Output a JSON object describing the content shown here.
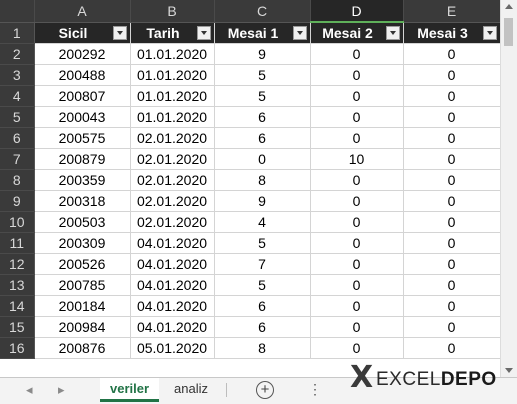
{
  "columns": [
    "A",
    "B",
    "C",
    "D",
    "E"
  ],
  "selected_column": "D",
  "header_row_number": "1",
  "headers": [
    "Sicil",
    "Tarih",
    "Mesai 1",
    "Mesai 2",
    "Mesai 3"
  ],
  "rows": [
    {
      "n": "2",
      "sicil": "200292",
      "tarih": "01.01.2020",
      "m1": "9",
      "m2": "0",
      "m3": "0"
    },
    {
      "n": "3",
      "sicil": "200488",
      "tarih": "01.01.2020",
      "m1": "5",
      "m2": "0",
      "m3": "0"
    },
    {
      "n": "4",
      "sicil": "200807",
      "tarih": "01.01.2020",
      "m1": "5",
      "m2": "0",
      "m3": "0"
    },
    {
      "n": "5",
      "sicil": "200043",
      "tarih": "01.01.2020",
      "m1": "6",
      "m2": "0",
      "m3": "0"
    },
    {
      "n": "6",
      "sicil": "200575",
      "tarih": "02.01.2020",
      "m1": "6",
      "m2": "0",
      "m3": "0"
    },
    {
      "n": "7",
      "sicil": "200879",
      "tarih": "02.01.2020",
      "m1": "0",
      "m2": "10",
      "m3": "0"
    },
    {
      "n": "8",
      "sicil": "200359",
      "tarih": "02.01.2020",
      "m1": "8",
      "m2": "0",
      "m3": "0"
    },
    {
      "n": "9",
      "sicil": "200318",
      "tarih": "02.01.2020",
      "m1": "9",
      "m2": "0",
      "m3": "0"
    },
    {
      "n": "10",
      "sicil": "200503",
      "tarih": "02.01.2020",
      "m1": "4",
      "m2": "0",
      "m3": "0"
    },
    {
      "n": "11",
      "sicil": "200309",
      "tarih": "04.01.2020",
      "m1": "5",
      "m2": "0",
      "m3": "0"
    },
    {
      "n": "12",
      "sicil": "200526",
      "tarih": "04.01.2020",
      "m1": "7",
      "m2": "0",
      "m3": "0"
    },
    {
      "n": "13",
      "sicil": "200785",
      "tarih": "04.01.2020",
      "m1": "5",
      "m2": "0",
      "m3": "0"
    },
    {
      "n": "14",
      "sicil": "200184",
      "tarih": "04.01.2020",
      "m1": "6",
      "m2": "0",
      "m3": "0"
    },
    {
      "n": "15",
      "sicil": "200984",
      "tarih": "04.01.2020",
      "m1": "6",
      "m2": "0",
      "m3": "0"
    },
    {
      "n": "16",
      "sicil": "200876",
      "tarih": "05.01.2020",
      "m1": "8",
      "m2": "0",
      "m3": "0"
    }
  ],
  "tabs": {
    "nav_prev": "◂",
    "nav_next": "▸",
    "active": "veriler",
    "inactive": "analiz",
    "add": "+",
    "more": "⋮"
  },
  "logo": {
    "mark": "X",
    "text_light": "EXCEL",
    "text_bold": "DEPO"
  },
  "colors": {
    "header_bg": "#262626",
    "tab_accent": "#217346",
    "selected_col_underline": "#5fb05a"
  }
}
